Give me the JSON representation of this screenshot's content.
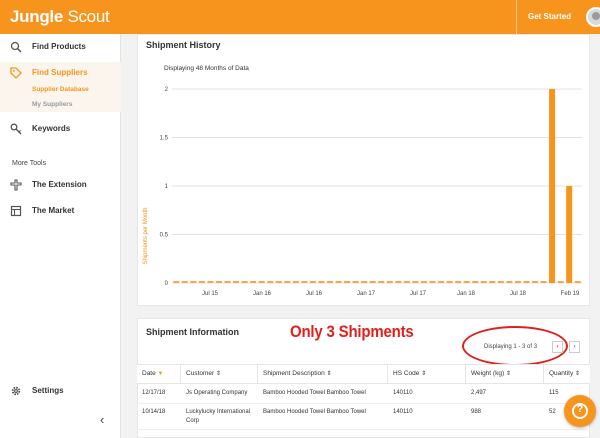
{
  "header": {
    "logo_part1": "Jungle",
    "logo_part2": "Scout",
    "get_started": "Get Started"
  },
  "sidebar": {
    "items": [
      {
        "label": "Find Products",
        "icon": "search-icon"
      },
      {
        "label": "Find Suppliers",
        "icon": "tag-icon"
      },
      {
        "label": "Keywords",
        "icon": "key-icon"
      },
      {
        "label": "The Extension",
        "icon": "puzzle-icon"
      },
      {
        "label": "The Market",
        "icon": "store-icon"
      },
      {
        "label": "Settings",
        "icon": "gear-icon"
      }
    ],
    "sub_items": [
      {
        "label": "Supplier Database"
      },
      {
        "label": "My Suppliers"
      }
    ],
    "more_tools": "More Tools",
    "collapse": "‹"
  },
  "shipment_history": {
    "title": "Shipment History",
    "subtitle": "Displaying 48 Months of Data"
  },
  "chart_data": {
    "type": "bar",
    "ylabel": "Shipments per Month",
    "ylim": [
      0,
      2
    ],
    "yticks": [
      "0",
      "0.5",
      "1",
      "1.5",
      "2"
    ],
    "xticks": [
      "Jul 15",
      "Jan 16",
      "Jul 16",
      "Jan 17",
      "Jul 17",
      "Jan 18",
      "Jul 18",
      "Feb 19"
    ],
    "months": 48,
    "values": [
      0,
      0,
      0,
      0,
      0,
      0,
      0,
      0,
      0,
      0,
      0,
      0,
      0,
      0,
      0,
      0,
      0,
      0,
      0,
      0,
      0,
      0,
      0,
      0,
      0,
      0,
      0,
      0,
      0,
      0,
      0,
      0,
      0,
      0,
      0,
      0,
      0,
      0,
      0,
      0,
      0,
      0,
      0,
      0,
      2,
      0,
      1,
      0
    ],
    "color": "#f7941d",
    "grid": true
  },
  "shipment_info": {
    "title": "Shipment Information",
    "annotation": "Only 3 Shipments",
    "pager": "Displaying 1 - 3 of 3",
    "prev": "‹",
    "next": "›",
    "columns": [
      "Date",
      "Customer",
      "Shipment Description",
      "HS Code",
      "Weight (kg)",
      "Quantity"
    ],
    "rows": [
      [
        "12/17/18",
        "Js Operating Company",
        "Bamboo Hooded Towel Bamboo Towel",
        "140110",
        "2,497",
        "115"
      ],
      [
        "10/14/18",
        "Luckylucky International Corp",
        "Bamboo Hooded Towel Bamboo Towel",
        "140110",
        "988",
        "52"
      ]
    ]
  },
  "help": "?"
}
